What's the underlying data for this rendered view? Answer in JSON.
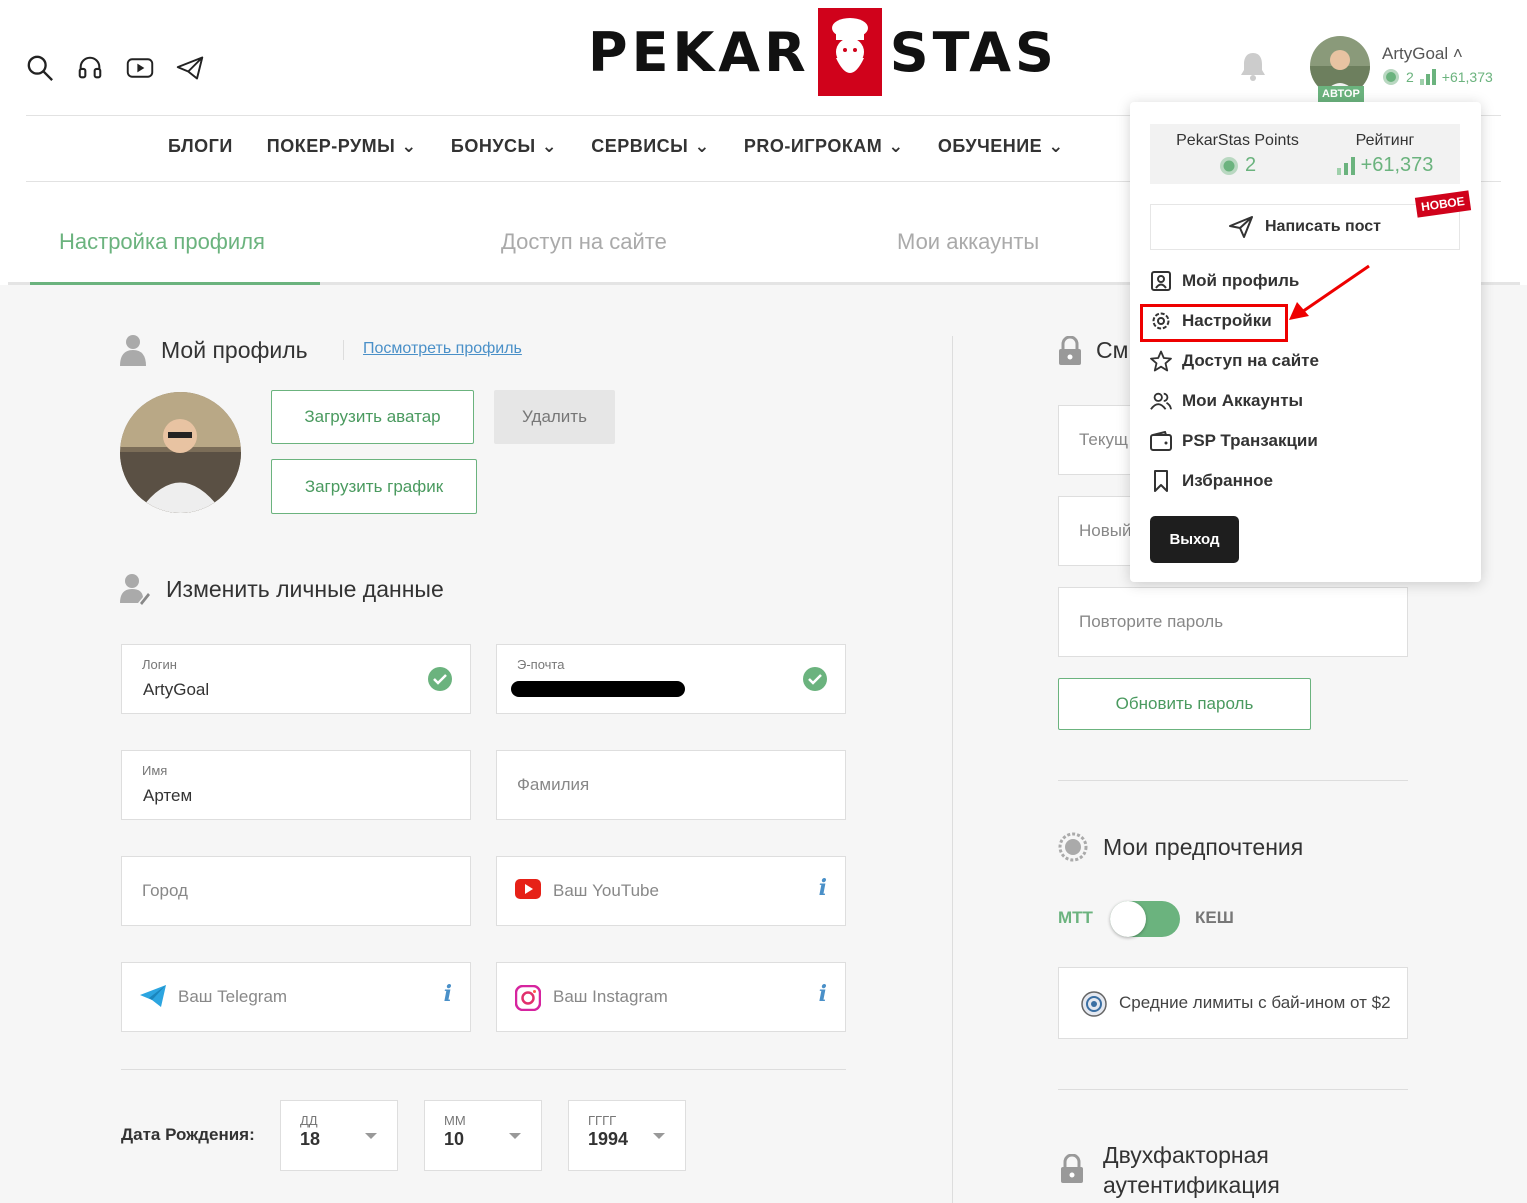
{
  "header": {
    "logo_left": "PEKAR",
    "logo_right": "STAS",
    "user": {
      "name": "ArtyGoal",
      "badge": "АВТОР",
      "points": "2",
      "rating": "+61,373"
    }
  },
  "nav": [
    "БЛОГИ",
    "ПОКЕР-РУМЫ",
    "БОНУСЫ",
    "СЕРВИСЫ",
    "PRO-ИГРОКАМ",
    "ОБУЧЕНИЕ"
  ],
  "tabs": {
    "settings": "Настройка профиля",
    "access": "Доступ на сайте",
    "accounts": "Мои аккаунты"
  },
  "profile": {
    "title": "Мой профиль",
    "view_link": "Посмотреть профиль",
    "upload_avatar": "Загрузить аватар",
    "delete": "Удалить",
    "upload_chart": "Загрузить график"
  },
  "personal": {
    "title": "Изменить личные данные",
    "login_label": "Логин",
    "login_value": "ArtyGoal",
    "email_label": "Э-почта",
    "name_label": "Имя",
    "name_value": "Артем",
    "surname_ph": "Фамилия",
    "city_ph": "Город",
    "youtube_ph": "Ваш YouTube",
    "telegram_ph": "Ваш Telegram",
    "instagram_ph": "Ваш Instagram",
    "info_glyph": "i"
  },
  "dob": {
    "label": "Дата Рождения:",
    "day_label": "ДД",
    "day": "18",
    "month_label": "ММ",
    "month": "10",
    "year_label": "ГГГГ",
    "year": "1994"
  },
  "password": {
    "title_partial": "См",
    "current_ph": "Текущ",
    "new_ph": "Новый",
    "repeat_ph": "Повторите пароль",
    "update": "Обновить пароль"
  },
  "prefs": {
    "title": "Мои предпочтения",
    "left": "МТТ",
    "right": "КЕШ",
    "limits": "Средние лимиты с бай-ином от $2"
  },
  "twofa": {
    "line1": "Двухфакторная",
    "line2": "аутентификация"
  },
  "dropdown": {
    "points_title": "PekarStas Points",
    "points_value": "2",
    "rating_title": "Рейтинг",
    "rating_value": "+61,373",
    "write_post": "Написать пост",
    "new_badge": "НОВОЕ",
    "items": [
      "Мой профиль",
      "Настройки",
      "Доступ на сайте",
      "Мои Аккаунты",
      "PSP Транзакции",
      "Избранное"
    ],
    "logout": "Выход"
  },
  "colors": {
    "accent": "#6bb37e",
    "link": "#4a90c8",
    "brand_red": "#d0021b",
    "highlight": "#ee0000"
  }
}
